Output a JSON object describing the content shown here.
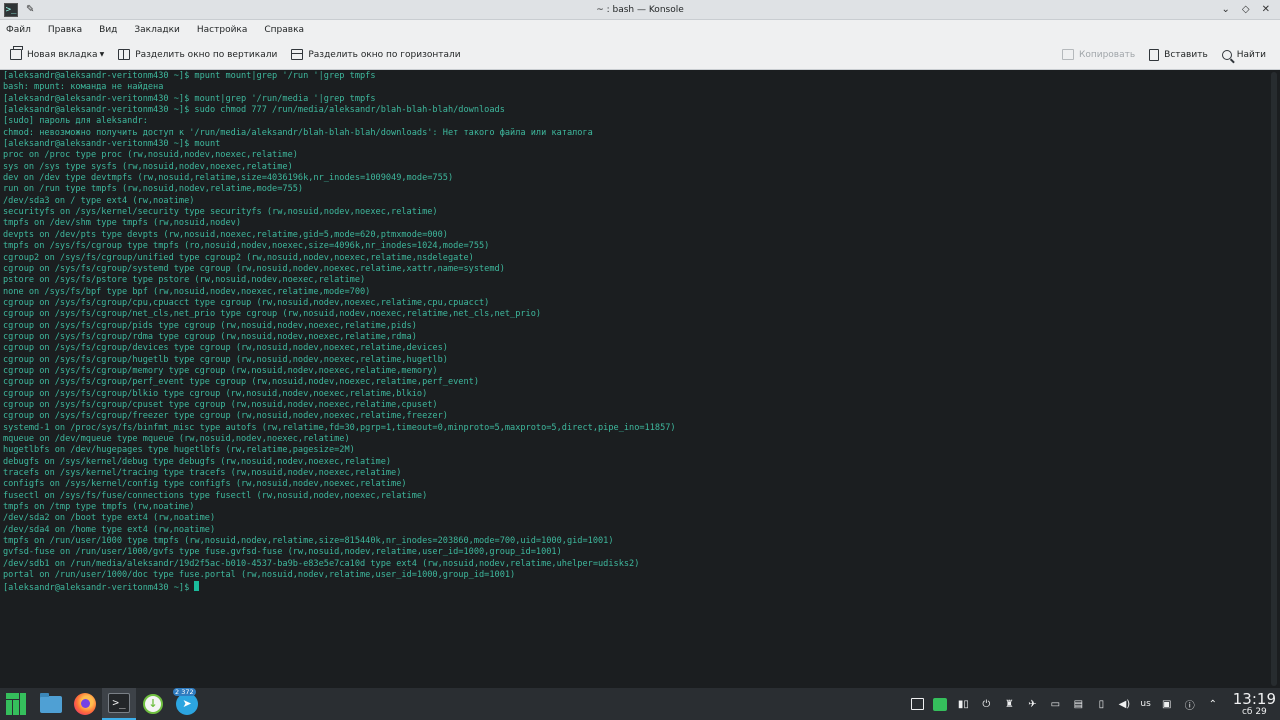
{
  "window": {
    "title": "~ : bash — Konsole",
    "app_icon": ">_",
    "pin_icon": "✎",
    "controls": [
      "⌄",
      "◇",
      "✕"
    ]
  },
  "menubar": {
    "items": [
      "Файл",
      "Правка",
      "Вид",
      "Закладки",
      "Настройка",
      "Справка"
    ]
  },
  "toolbar": {
    "new_tab": "Новая вкладка",
    "split_vertical": "Разделить окно по вертикали",
    "split_horizontal": "Разделить окно по горизонтали",
    "copy": "Копировать",
    "paste": "Вставить",
    "find": "Найти"
  },
  "terminal": {
    "lines": [
      "[aleksandr@aleksandr-veritonm430 ~]$ mpunt mount|grep '/run '|grep tmpfs",
      "bash: mpunt: команда не найдена",
      "[aleksandr@aleksandr-veritonm430 ~]$ mount|grep '/run/media '|grep tmpfs",
      "[aleksandr@aleksandr-veritonm430 ~]$ sudo chmod 777 /run/media/aleksandr/blah-blah-blah/downloads",
      "[sudo] пароль для aleksandr:",
      "chmod: невозможно получить доступ к '/run/media/aleksandr/blah-blah-blah/downloads': Нет такого файла или каталога",
      "[aleksandr@aleksandr-veritonm430 ~]$ mount",
      "proc on /proc type proc (rw,nosuid,nodev,noexec,relatime)",
      "sys on /sys type sysfs (rw,nosuid,nodev,noexec,relatime)",
      "dev on /dev type devtmpfs (rw,nosuid,relatime,size=4036196k,nr_inodes=1009049,mode=755)",
      "run on /run type tmpfs (rw,nosuid,nodev,relatime,mode=755)",
      "/dev/sda3 on / type ext4 (rw,noatime)",
      "securityfs on /sys/kernel/security type securityfs (rw,nosuid,nodev,noexec,relatime)",
      "tmpfs on /dev/shm type tmpfs (rw,nosuid,nodev)",
      "devpts on /dev/pts type devpts (rw,nosuid,noexec,relatime,gid=5,mode=620,ptmxmode=000)",
      "tmpfs on /sys/fs/cgroup type tmpfs (ro,nosuid,nodev,noexec,size=4096k,nr_inodes=1024,mode=755)",
      "cgroup2 on /sys/fs/cgroup/unified type cgroup2 (rw,nosuid,nodev,noexec,relatime,nsdelegate)",
      "cgroup on /sys/fs/cgroup/systemd type cgroup (rw,nosuid,nodev,noexec,relatime,xattr,name=systemd)",
      "pstore on /sys/fs/pstore type pstore (rw,nosuid,nodev,noexec,relatime)",
      "none on /sys/fs/bpf type bpf (rw,nosuid,nodev,noexec,relatime,mode=700)",
      "cgroup on /sys/fs/cgroup/cpu,cpuacct type cgroup (rw,nosuid,nodev,noexec,relatime,cpu,cpuacct)",
      "cgroup on /sys/fs/cgroup/net_cls,net_prio type cgroup (rw,nosuid,nodev,noexec,relatime,net_cls,net_prio)",
      "cgroup on /sys/fs/cgroup/pids type cgroup (rw,nosuid,nodev,noexec,relatime,pids)",
      "cgroup on /sys/fs/cgroup/rdma type cgroup (rw,nosuid,nodev,noexec,relatime,rdma)",
      "cgroup on /sys/fs/cgroup/devices type cgroup (rw,nosuid,nodev,noexec,relatime,devices)",
      "cgroup on /sys/fs/cgroup/hugetlb type cgroup (rw,nosuid,nodev,noexec,relatime,hugetlb)",
      "cgroup on /sys/fs/cgroup/memory type cgroup (rw,nosuid,nodev,noexec,relatime,memory)",
      "cgroup on /sys/fs/cgroup/perf_event type cgroup (rw,nosuid,nodev,noexec,relatime,perf_event)",
      "cgroup on /sys/fs/cgroup/blkio type cgroup (rw,nosuid,nodev,noexec,relatime,blkio)",
      "cgroup on /sys/fs/cgroup/cpuset type cgroup (rw,nosuid,nodev,noexec,relatime,cpuset)",
      "cgroup on /sys/fs/cgroup/freezer type cgroup (rw,nosuid,nodev,noexec,relatime,freezer)",
      "systemd-1 on /proc/sys/fs/binfmt_misc type autofs (rw,relatime,fd=30,pgrp=1,timeout=0,minproto=5,maxproto=5,direct,pipe_ino=11857)",
      "mqueue on /dev/mqueue type mqueue (rw,nosuid,nodev,noexec,relatime)",
      "hugetlbfs on /dev/hugepages type hugetlbfs (rw,relatime,pagesize=2M)",
      "debugfs on /sys/kernel/debug type debugfs (rw,nosuid,nodev,noexec,relatime)",
      "tracefs on /sys/kernel/tracing type tracefs (rw,nosuid,nodev,noexec,relatime)",
      "configfs on /sys/kernel/config type configfs (rw,nosuid,nodev,noexec,relatime)",
      "fusectl on /sys/fs/fuse/connections type fusectl (rw,nosuid,nodev,noexec,relatime)",
      "tmpfs on /tmp type tmpfs (rw,noatime)",
      "/dev/sda2 on /boot type ext4 (rw,noatime)",
      "/dev/sda4 on /home type ext4 (rw,noatime)",
      "tmpfs on /run/user/1000 type tmpfs (rw,nosuid,nodev,relatime,size=815440k,nr_inodes=203860,mode=700,uid=1000,gid=1001)",
      "gvfsd-fuse on /run/user/1000/gvfs type fuse.gvfsd-fuse (rw,nosuid,nodev,relatime,user_id=1000,group_id=1001)",
      "/dev/sdb1 on /run/media/aleksandr/19d2f5ac-b010-4537-ba9b-e83e5e7ca10d type ext4 (rw,nosuid,nodev,relatime,uhelper=udisks2)",
      "portal on /run/user/1000/doc type fuse.portal (rw,nosuid,nodev,relatime,user_id=1000,group_id=1001)",
      "[aleksandr@aleksandr-veritonm430 ~]$ "
    ],
    "text_color": "#3eb89d",
    "background": "#1b1e20"
  },
  "taskbar": {
    "telegram_badge": "2 372",
    "keyboard_layout": "us",
    "time": "13:19",
    "date": "сб 29",
    "accent": "#3daee9"
  }
}
